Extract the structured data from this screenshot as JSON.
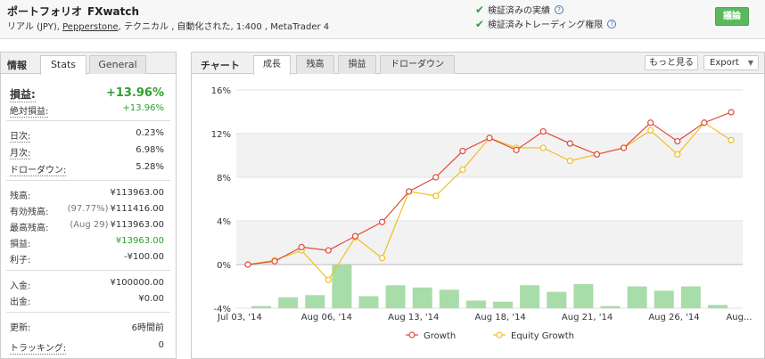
{
  "header": {
    "title": "ポートフォリオ",
    "account_name": "FXwatch",
    "sub_prefix": "リアル (JPY),",
    "broker": "Pepperstone",
    "sub_suffix": ", テクニカル , 自動化された, 1:400 , MetaTrader 4",
    "verified_track": "検証済みの実績",
    "verified_trading": "検証済みトレーディング権限",
    "help_glyph": "?",
    "discuss_button": "議論",
    "colors": {
      "accent_green": "#5cb85c",
      "check_green": "#3a9a3a"
    }
  },
  "left": {
    "tab_label": "情報",
    "tabs": [
      "Stats",
      "General"
    ],
    "gain": {
      "label": "損益:",
      "value": "+13.96%"
    },
    "abs_gain": {
      "label": "絶対損益:",
      "value": "+13.96%"
    },
    "daily": {
      "label": "日次:",
      "value": "0.23%"
    },
    "monthly": {
      "label": "月次:",
      "value": "6.98%"
    },
    "drawdown": {
      "label": "ドローダウン:",
      "value": "5.28%"
    },
    "balance": {
      "label": "残高:",
      "value": "¥113963.00"
    },
    "equity": {
      "label": "有効残高:",
      "note": "(97.77%)",
      "value": "¥111416.00"
    },
    "highest": {
      "label": "最高残高:",
      "note": "(Aug 29)",
      "value": "¥113963.00"
    },
    "profit": {
      "label": "損益:",
      "value": "¥13963.00"
    },
    "interest": {
      "label": "利子:",
      "value": "-¥100.00"
    },
    "deposits": {
      "label": "入金:",
      "value": "¥100000.00"
    },
    "withdrawals": {
      "label": "出金:",
      "value": "¥0.00"
    },
    "updated": {
      "label": "更新:",
      "value": "6時間前"
    },
    "tracking": {
      "label": "トラッキング:",
      "value": "0"
    }
  },
  "chart_panel": {
    "tab_label": "チャート",
    "tabs": [
      "成長",
      "残高",
      "損益",
      "ドローダウン"
    ],
    "active_tab": "成長",
    "more_button": "もっと見る",
    "export_button": "Export",
    "export_caret": "▼"
  },
  "chart_data": {
    "type": "line",
    "x": [
      "Jul 03, '14",
      "",
      "",
      "",
      "",
      "",
      "",
      "",
      "",
      "",
      "",
      "",
      "",
      "",
      "",
      "",
      "",
      "",
      "",
      "",
      "",
      "",
      "",
      ""
    ],
    "xtick_labels": [
      "Jul 03, '14",
      "Aug 06, '14",
      "Aug 13, '14",
      "Aug 18, '14",
      "Aug 21, '14",
      "Aug 26, '14",
      "Aug..."
    ],
    "xtick_index": [
      0,
      4,
      8,
      12,
      16,
      20,
      23
    ],
    "series": [
      {
        "name": "Growth",
        "color": "#e04a3a",
        "values": [
          0.0,
          0.3,
          1.6,
          1.3,
          2.6,
          3.9,
          6.7,
          8.0,
          10.4,
          11.6,
          10.5,
          12.2,
          11.1,
          10.1,
          10.7,
          13.0,
          11.3,
          13.0,
          13.96
        ]
      },
      {
        "name": "Equity Growth",
        "color": "#f0c020",
        "values": [
          0.0,
          0.4,
          1.3,
          -1.4,
          2.5,
          0.6,
          6.7,
          6.3,
          8.7,
          11.6,
          10.7,
          10.7,
          9.5,
          10.1,
          10.7,
          12.3,
          10.1,
          13.0,
          11.4
        ]
      }
    ],
    "bars": {
      "name": "",
      "color": "#a8dca8",
      "values": [
        -3.8,
        -3.0,
        -2.8,
        0.0,
        -2.9,
        -1.9,
        -2.1,
        -2.3,
        -3.3,
        -3.4,
        -1.9,
        -2.5,
        -1.8,
        -3.8,
        -2.0,
        -2.4,
        -2.0,
        -3.7
      ]
    },
    "yticks": [
      "16%",
      "12%",
      "8%",
      "4%",
      "0%",
      "-4%"
    ],
    "ylim": [
      -4,
      16
    ],
    "grid": true,
    "legend": "bottom"
  }
}
